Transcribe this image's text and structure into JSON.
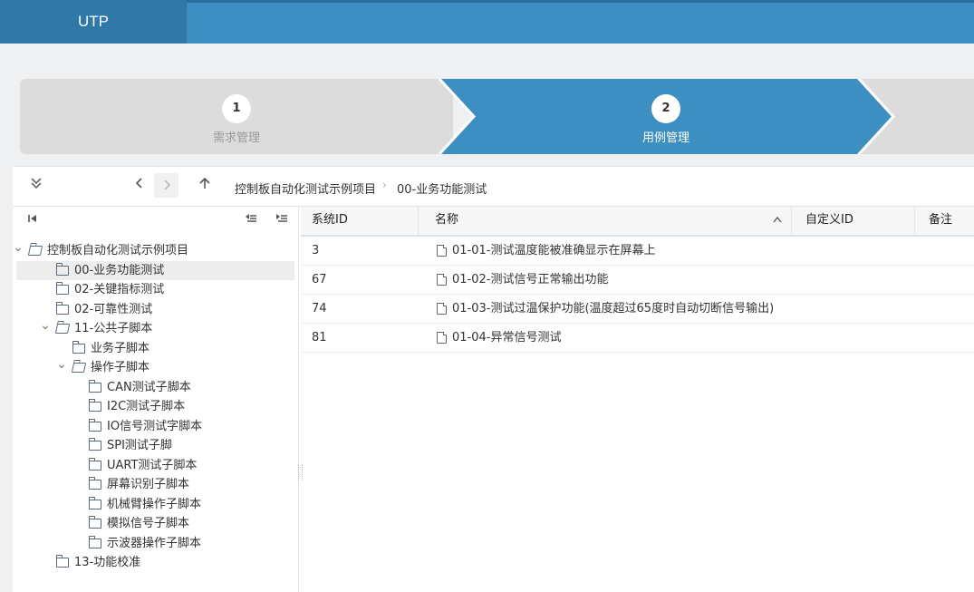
{
  "app": {
    "title": "UTP"
  },
  "steps": [
    {
      "num": "1",
      "label": "需求管理"
    },
    {
      "num": "2",
      "label": "用例管理"
    }
  ],
  "toolbar": {
    "collapse_icon": "double-chevron-down-icon",
    "back_icon": "chevron-left-icon",
    "forward_icon": "chevron-right-icon",
    "up_icon": "arrow-up-icon",
    "breadcrumb": [
      "控制板自动化测试示例项目",
      "00-业务功能测试"
    ]
  },
  "tree": {
    "nodes": [
      {
        "label": "控制板自动化测试示例项目",
        "level": 0,
        "expanded": true
      },
      {
        "label": "00-业务功能测试",
        "level": 1,
        "selected": true
      },
      {
        "label": "02-关键指标测试",
        "level": 1
      },
      {
        "label": "02-可靠性测试",
        "level": 1
      },
      {
        "label": "11-公共子脚本",
        "level": 1,
        "expanded": true
      },
      {
        "label": "业务子脚本",
        "level": 2
      },
      {
        "label": "操作子脚本",
        "level": 2,
        "expanded": true
      },
      {
        "label": "CAN测试子脚本",
        "level": 3
      },
      {
        "label": "I2C测试子脚本",
        "level": 3
      },
      {
        "label": "IO信号测试字脚本",
        "level": 3
      },
      {
        "label": "SPI测试子脚",
        "level": 3
      },
      {
        "label": "UART测试子脚本",
        "level": 3
      },
      {
        "label": "屏幕识别子脚本",
        "level": 3
      },
      {
        "label": "机械臂操作子脚本",
        "level": 3
      },
      {
        "label": "模拟信号子脚本",
        "level": 3
      },
      {
        "label": "示波器操作子脚本",
        "level": 3
      },
      {
        "label": "13-功能校准",
        "level": 1
      }
    ]
  },
  "grid": {
    "columns": [
      "系统ID",
      "名称",
      "自定义ID",
      "备注"
    ],
    "sort_icon": "chevron-up-icon",
    "rows": [
      {
        "id": "3",
        "name": "01-01-测试温度能被准确显示在屏幕上"
      },
      {
        "id": "67",
        "name": "01-02-测试信号正常输出功能"
      },
      {
        "id": "74",
        "name": "01-03-测试过温保护功能(温度超过65度时自动切断信号输出)"
      },
      {
        "id": "81",
        "name": "01-04-异常信号测试"
      }
    ]
  },
  "colors": {
    "primary": "#3d8fc1",
    "header_dark": "#2f78a8",
    "step_inactive": "#dcdcdc"
  }
}
